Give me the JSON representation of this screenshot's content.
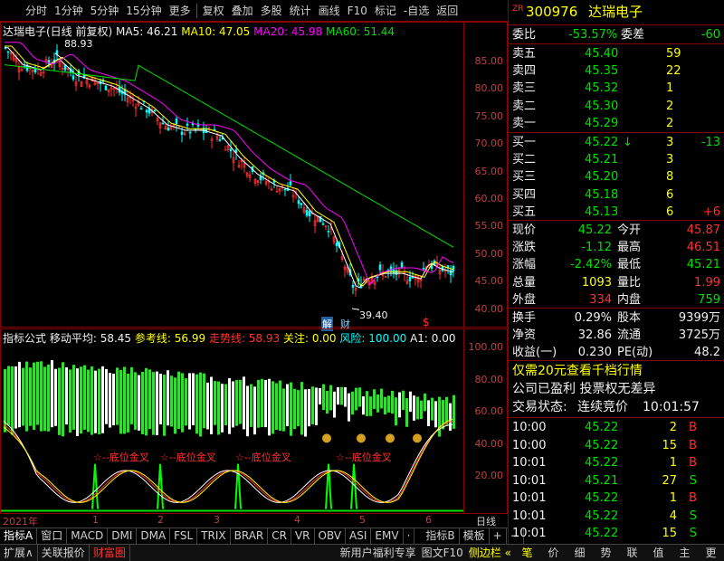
{
  "toolbar": {
    "items": [
      "分时",
      "1分钟",
      "5分钟",
      "15分钟",
      "更多",
      "复权",
      "叠加",
      "多股",
      "统计",
      "画线",
      "F10",
      "标记",
      "-自选",
      "返回"
    ]
  },
  "kline": {
    "title": "达瑞电子(日线 前复权)",
    "ma5": "MA5: 46.21",
    "ma10": "MA10: 47.05",
    "ma20": "MA20: 45.98",
    "ma60": "MA60: 51.44",
    "high_label": "88.93",
    "low_label": "39.40",
    "axis": [
      "85.00",
      "80.00",
      "75.00",
      "70.00",
      "65.00",
      "60.00",
      "55.00",
      "50.00",
      "45.00",
      "40.00"
    ],
    "marker_jie": "解",
    "marker_cai": "财",
    "marker_dollar": "$"
  },
  "indicator": {
    "title": "指标公式",
    "v1": "移动平均: 58.45",
    "v2": "参考线: 56.99",
    "v3": "走势线: 58.93",
    "v4": "关注: 0.00",
    "v5": "风险: 100.00",
    "v6": "A1: 0.00",
    "axis": [
      "100.00",
      "80.00",
      "60.00",
      "40.00",
      "20.00"
    ],
    "signal": "底位金叉",
    "signal_prefix": "☆"
  },
  "timeaxis": {
    "year": "2021年",
    "months": [
      "1",
      "2",
      "3",
      "4",
      "5",
      "6"
    ],
    "right": "日线"
  },
  "tabs": [
    "指标A",
    "窗口",
    "MACD",
    "DMI",
    "DMA",
    "FSL",
    "TRIX",
    "BRAR",
    "CR",
    "VR",
    "OBV",
    "ASI",
    "EMV",
    "·"
  ],
  "tabs_right": [
    "指标B",
    "模板",
    "+",
    "−"
  ],
  "bottom": {
    "left": [
      "扩展∧",
      "关联报价",
      "财富圈"
    ],
    "right": [
      "新用户福利专享",
      "图文F10",
      "侧边栏 «"
    ],
    "side": [
      "笔",
      "价",
      "细",
      "势",
      "联",
      "值",
      "主",
      "更"
    ]
  },
  "quote": {
    "code": "300976",
    "name": "达瑞电子",
    "wei_bi_label": "委比",
    "wei_bi": "-53.57%",
    "wei_cha_label": "委差",
    "wei_cha": "-60",
    "asks": [
      {
        "l": "卖五",
        "p": "45.40",
        "v": "59"
      },
      {
        "l": "卖四",
        "p": "45.35",
        "v": "22"
      },
      {
        "l": "卖三",
        "p": "45.32",
        "v": "1"
      },
      {
        "l": "卖二",
        "p": "45.30",
        "v": "2"
      },
      {
        "l": "卖一",
        "p": "45.29",
        "v": "2"
      }
    ],
    "bids": [
      {
        "l": "买一",
        "p": "45.22",
        "v": "3",
        "c": "-13",
        "a": "↓"
      },
      {
        "l": "买二",
        "p": "45.21",
        "v": "3",
        "c": "",
        "a": ""
      },
      {
        "l": "买三",
        "p": "45.20",
        "v": "8",
        "c": "",
        "a": ""
      },
      {
        "l": "买四",
        "p": "45.18",
        "v": "6",
        "c": "",
        "a": ""
      },
      {
        "l": "买五",
        "p": "45.13",
        "v": "6",
        "c": "+6",
        "a": ""
      }
    ],
    "stats": [
      [
        "现价",
        "45.22",
        "今开",
        "45.87"
      ],
      [
        "涨跌",
        "-1.12",
        "最高",
        "46.51"
      ],
      [
        "涨幅",
        "-2.42%",
        "最低",
        "45.21"
      ],
      [
        "总量",
        "1093",
        "量比",
        "1.99"
      ],
      [
        "外盘",
        "334",
        "内盘",
        "759"
      ]
    ],
    "stats2": [
      [
        "换手",
        "0.29%",
        "股本",
        "9399万"
      ],
      [
        "净资",
        "32.86",
        "流通",
        "3725万"
      ],
      [
        "收益(一)",
        "0.230",
        "PE(动)",
        "48.2"
      ]
    ],
    "promo": "仅需20元查看千档行情",
    "info": "公司已盈利 投票权无差异",
    "status_label": "交易状态:",
    "status": "连续竞价",
    "status_time": "10:01:57",
    "ticks": [
      [
        "10:00",
        "45.22",
        "2",
        "B"
      ],
      [
        "10:00",
        "45.22",
        "15",
        "B"
      ],
      [
        "10:01",
        "45.22",
        "1",
        "B"
      ],
      [
        "10:01",
        "45.21",
        "27",
        "S"
      ],
      [
        "10:01",
        "45.22",
        "1",
        "B"
      ],
      [
        "10:01",
        "45.22",
        "4",
        "S"
      ],
      [
        "10:01",
        "45.22",
        "15",
        "S"
      ]
    ]
  },
  "colors": {
    "up": "#ff3030",
    "down": "#00e000",
    "ma5": "#ffffff",
    "ma10": "#ffff00",
    "ma20": "#ff00ff",
    "ma60": "#00e000"
  }
}
